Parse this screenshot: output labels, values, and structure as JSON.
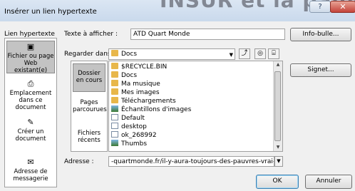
{
  "dialog": {
    "title": "Insérer un lien hypertexte",
    "background_text": "INSUR et la pauv"
  },
  "titlebar": {
    "help_glyph": "?",
    "close_glyph": "✕"
  },
  "link_to_label": "Lien hypertexte",
  "display_text": {
    "label": "Texte à afficher :",
    "value": "ATD Quart Monde"
  },
  "screentip_button": "Info-bulle...",
  "look_in": {
    "label": "Regarder dans :",
    "value": "Docs"
  },
  "bookmark_button": "Signet...",
  "left_nav": [
    {
      "label": "Fichier ou page Web existant(e)",
      "icon": "web-page-icon",
      "selected": true
    },
    {
      "label": "Emplacement dans ce document",
      "icon": "document-place-icon",
      "selected": false
    },
    {
      "label": "Créer un document",
      "icon": "new-document-icon",
      "selected": false
    },
    {
      "label": "Adresse de messagerie",
      "icon": "email-icon",
      "selected": false
    }
  ],
  "sub_nav": [
    {
      "label": "Dossier en cours",
      "selected": true
    },
    {
      "label": "Pages parcourues",
      "selected": false
    },
    {
      "label": "Fichiers récents",
      "selected": false
    }
  ],
  "files": [
    {
      "name": "$RECYCLE.BIN",
      "icon": "folder-icon"
    },
    {
      "name": "Docs",
      "icon": "folder-icon"
    },
    {
      "name": "Ma musique",
      "icon": "folder-icon"
    },
    {
      "name": "Mes images",
      "icon": "folder-icon"
    },
    {
      "name": "Téléchargements",
      "icon": "folder-icon"
    },
    {
      "name": "Échantillons d'images",
      "icon": "shortcut-icon"
    },
    {
      "name": "Default",
      "icon": "file-icon"
    },
    {
      "name": "desktop",
      "icon": "settings-file-icon"
    },
    {
      "name": "ok_268992",
      "icon": "file-icon"
    },
    {
      "name": "Thumbs",
      "icon": "image-file-icon"
    }
  ],
  "address": {
    "label": "Adresse :",
    "value": "-quartmonde.fr/il-y-aura-toujours-des-pauvres-vrai-ou-faux/"
  },
  "ok_button": "OK",
  "cancel_button": "Annuler"
}
